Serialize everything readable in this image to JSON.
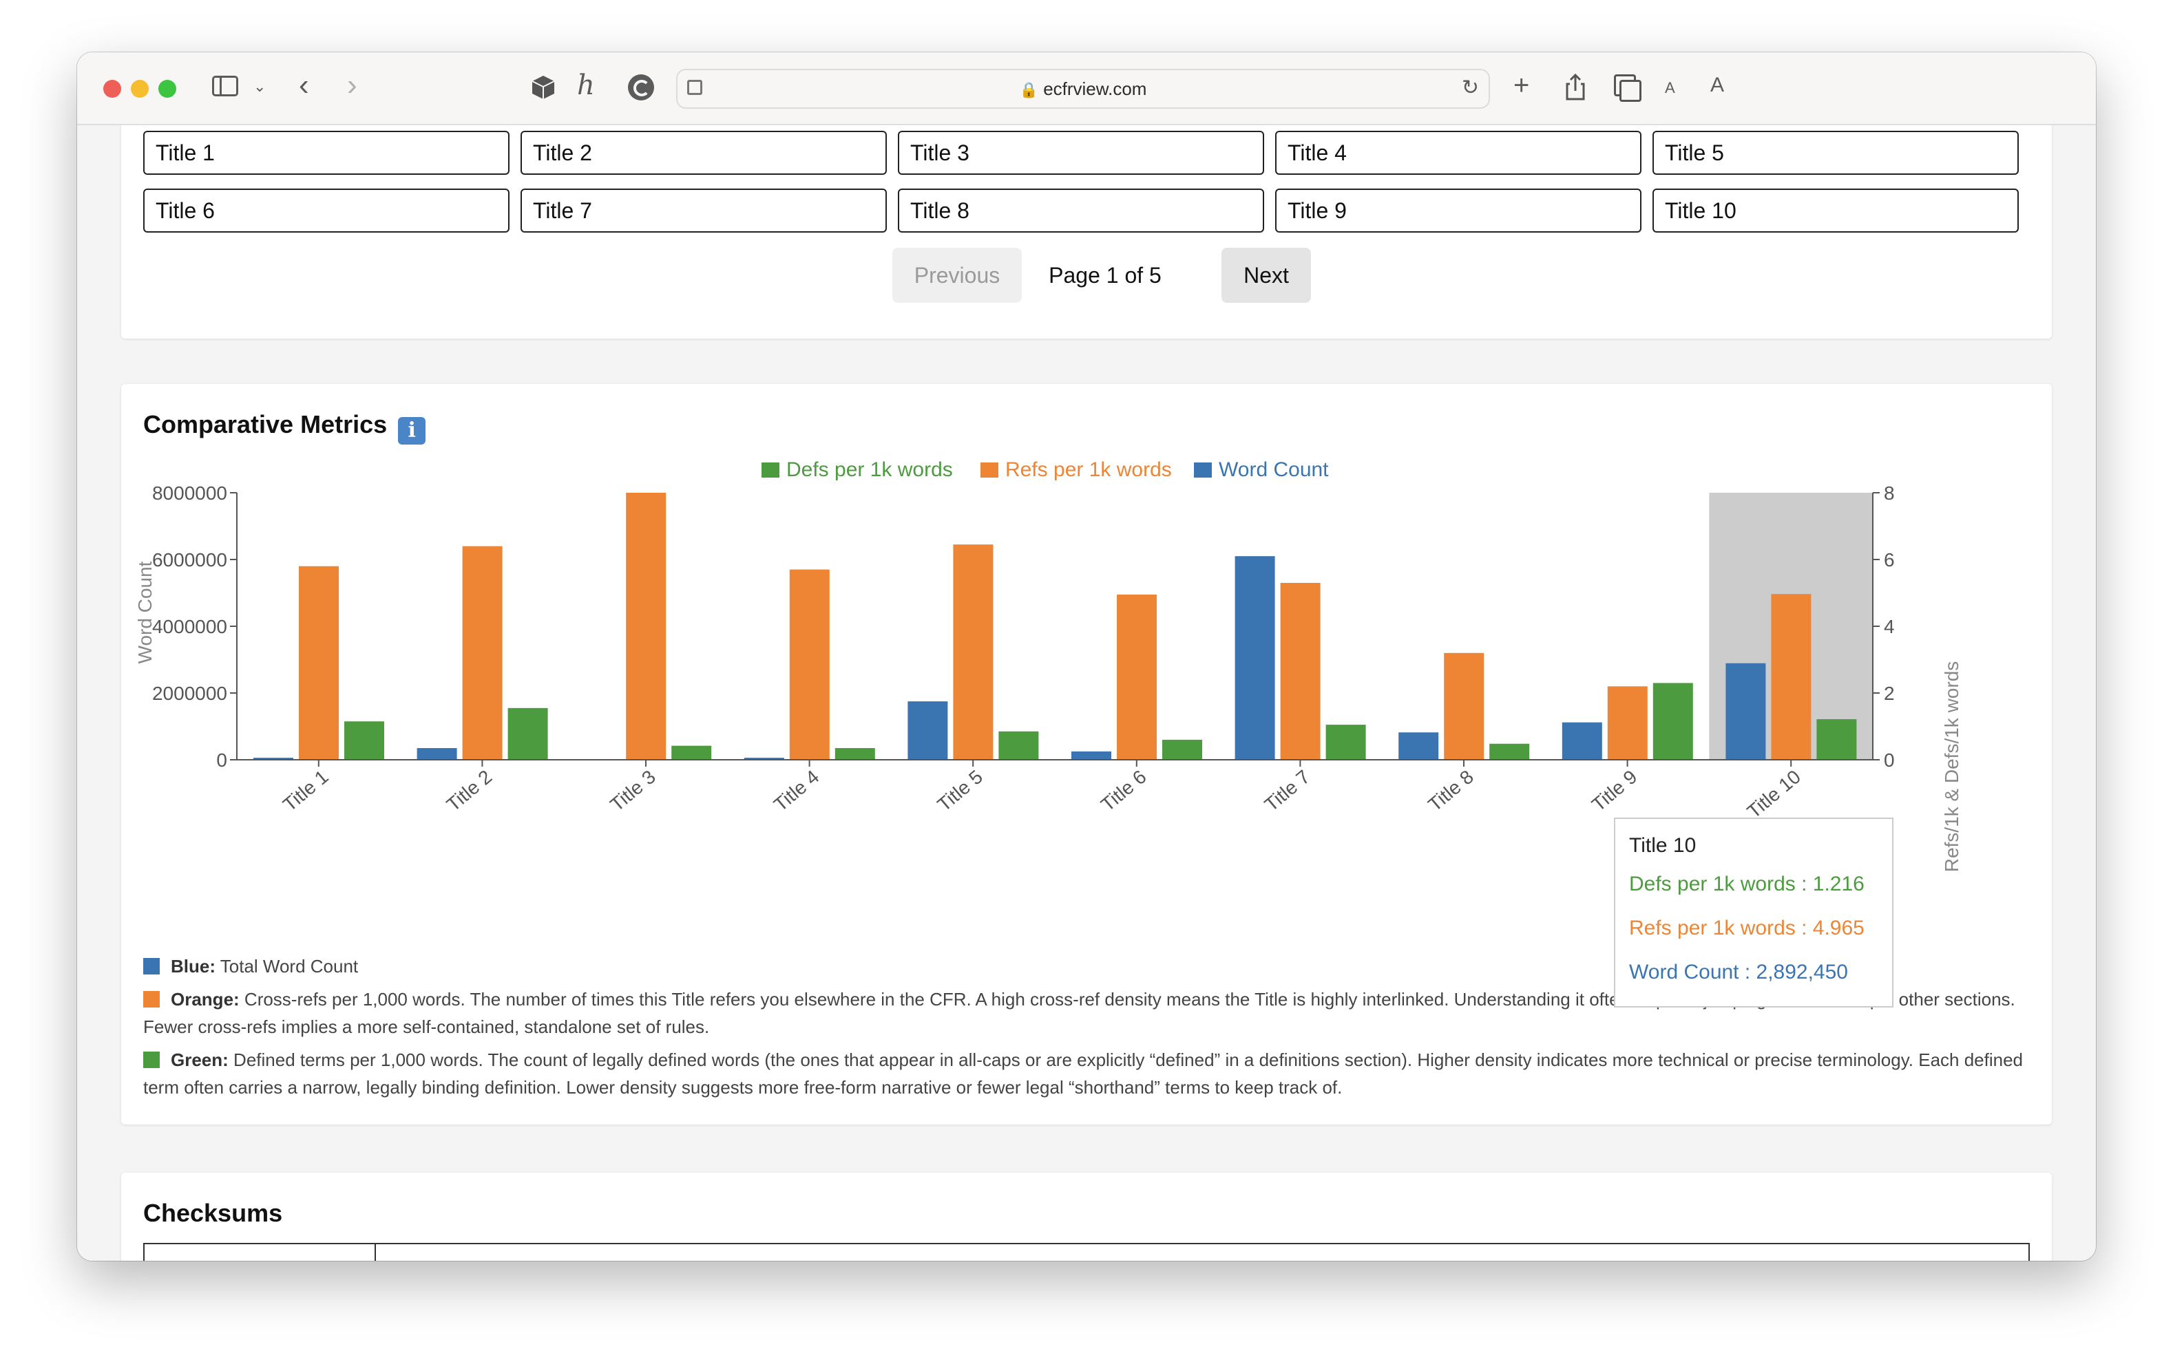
{
  "browser": {
    "url": "ecfrview.com"
  },
  "titles_grid": {
    "buttons": [
      "Title 1",
      "Title 2",
      "Title 3",
      "Title 4",
      "Title 5",
      "Title 6",
      "Title 7",
      "Title 8",
      "Title 9",
      "Title 10"
    ]
  },
  "pagination": {
    "previous_label": "Previous",
    "page_text": "Page 1 of 5",
    "next_label": "Next"
  },
  "metrics": {
    "heading": "Comparative Metrics",
    "info_icon": "information-icon",
    "descriptions": [
      {
        "color_key": "blue",
        "label": "Blue:",
        "text": " Total Word Count"
      },
      {
        "color_key": "orange",
        "label": "Orange:",
        "text": " Cross-refs per 1,000 words. The number of times this Title refers you elsewhere in the CFR. A high cross-ref density means the Title is highly interlinked. Understanding it often requires jumping around multiple other sections. Fewer cross-refs implies a more self-contained, standalone set of rules."
      },
      {
        "color_key": "green",
        "label": "Green:",
        "text": " Defined terms per 1,000 words. The count of legally defined words (the ones that appear in all-caps or are explicitly “defined” in a definitions section). Higher density indicates more technical or precise terminology. Each defined term often carries a narrow, legally binding definition. Lower density suggests more free-form narrative or fewer legal “shorthand” terms to keep track of."
      }
    ]
  },
  "tooltip": {
    "title": "Title 10",
    "defs_line": "Defs per 1k words : 1.216",
    "refs_line": "Refs per 1k words : 4.965",
    "words_line": "Word Count : 2,892,450"
  },
  "checksums": {
    "heading": "Checksums"
  },
  "colors": {
    "blue": "#3b75b1",
    "orange": "#ee8535",
    "green": "#4c9c3f",
    "highlight": "#cccccc"
  },
  "chart_data": {
    "type": "bar",
    "categories": [
      "Title 1",
      "Title 2",
      "Title 3",
      "Title 4",
      "Title 5",
      "Title 6",
      "Title 7",
      "Title 8",
      "Title 9",
      "Title 10"
    ],
    "series": [
      {
        "name": "Word Count",
        "axis": "left",
        "color_key": "blue",
        "values": [
          60000,
          350000,
          0,
          60000,
          1750000,
          250000,
          6100000,
          820000,
          1120000,
          2892450
        ]
      },
      {
        "name": "Refs per 1k words",
        "axis": "right",
        "color_key": "orange",
        "values": [
          5.8,
          6.4,
          8.0,
          5.7,
          6.45,
          4.95,
          5.3,
          3.2,
          2.2,
          4.965
        ]
      },
      {
        "name": "Defs per 1k words",
        "axis": "right",
        "color_key": "green",
        "values": [
          1.15,
          1.55,
          0.42,
          0.35,
          0.85,
          0.6,
          1.05,
          0.48,
          2.3,
          1.216
        ]
      }
    ],
    "legend_order": [
      "Defs per 1k words",
      "Refs per 1k words",
      "Word Count"
    ],
    "legend_placement": "top-center",
    "ylabel_left": "Word Count",
    "ylabel_right": "Refs/1k & Defs/1k words",
    "ylim_left": [
      0,
      8000000
    ],
    "ylim_right": [
      0,
      8
    ],
    "yticks_left": [
      "0",
      "2000000",
      "4000000",
      "6000000",
      "8000000"
    ],
    "yticks_right": [
      "0",
      "2",
      "4",
      "6",
      "8"
    ],
    "highlighted_category": "Title 10",
    "grid": false
  }
}
